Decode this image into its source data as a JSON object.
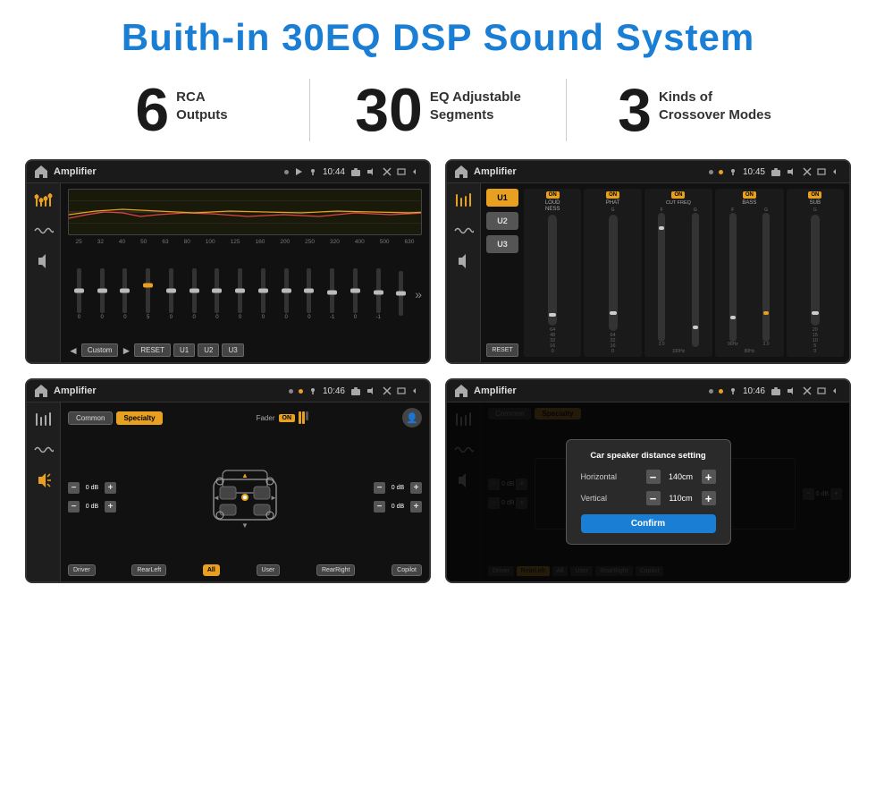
{
  "page": {
    "title": "Buith-in 30EQ DSP Sound System",
    "background": "#ffffff"
  },
  "stats": [
    {
      "number": "6",
      "label_line1": "RCA",
      "label_line2": "Outputs"
    },
    {
      "number": "30",
      "label_line1": "EQ Adjustable",
      "label_line2": "Segments"
    },
    {
      "number": "3",
      "label_line1": "Kinds of",
      "label_line2": "Crossover Modes"
    }
  ],
  "screen1": {
    "app_name": "Amplifier",
    "time": "10:44",
    "eq_freqs": [
      "25",
      "32",
      "40",
      "50",
      "63",
      "80",
      "100",
      "125",
      "160",
      "200",
      "250",
      "320",
      "400",
      "500",
      "630"
    ],
    "eq_values": [
      "0",
      "0",
      "0",
      "5",
      "0",
      "0",
      "0",
      "0",
      "0",
      "0",
      "0",
      "-1",
      "0",
      "-1",
      ""
    ],
    "buttons": [
      "Custom",
      "RESET",
      "U1",
      "U2",
      "U3"
    ]
  },
  "screen2": {
    "app_name": "Amplifier",
    "time": "10:45",
    "presets": [
      "U1",
      "U2",
      "U3"
    ],
    "channels": [
      {
        "label": "LOUDNESS",
        "on": true
      },
      {
        "label": "PHAT",
        "on": true
      },
      {
        "label": "CUT FREQ",
        "on": true
      },
      {
        "label": "BASS",
        "on": true
      },
      {
        "label": "SUB",
        "on": true
      }
    ],
    "reset_label": "RESET"
  },
  "screen3": {
    "app_name": "Amplifier",
    "time": "10:46",
    "tabs": [
      "Common",
      "Specialty"
    ],
    "active_tab": "Specialty",
    "fader_label": "Fader",
    "fader_on": "ON",
    "db_controls": [
      "0 dB",
      "0 dB",
      "0 dB",
      "0 dB"
    ],
    "bottom_btns": [
      "Driver",
      "RearLeft",
      "All",
      "User",
      "RearRight",
      "Copilot"
    ]
  },
  "screen4": {
    "app_name": "Amplifier",
    "time": "10:46",
    "tabs": [
      "Common",
      "Specialty"
    ],
    "dialog": {
      "title": "Car speaker distance setting",
      "horizontal_label": "Horizontal",
      "horizontal_value": "140cm",
      "vertical_label": "Vertical",
      "vertical_value": "110cm",
      "confirm_label": "Confirm"
    },
    "db_controls": [
      "0 dB",
      "0 dB"
    ],
    "bottom_btns": [
      "Driver",
      "RearLeft",
      "All",
      "User",
      "RearRight",
      "Copilot"
    ]
  }
}
